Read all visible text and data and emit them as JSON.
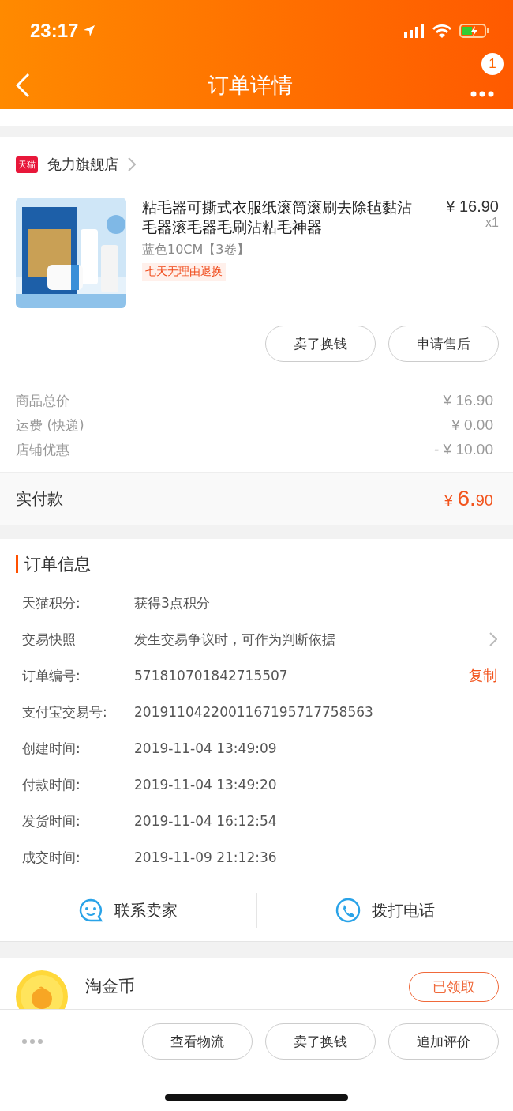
{
  "status_bar": {
    "time": "23:17"
  },
  "nav": {
    "title": "订单详情",
    "badge": "1"
  },
  "store": {
    "badge": "天猫",
    "name": "兔力旗舰店"
  },
  "product": {
    "kind": "picture",
    "title": "粘毛器可撕式衣服纸滚筒滚刷去除毡黏沾毛器滚毛器毛刷沾粘毛神器",
    "price": "¥ 16.90",
    "quantity": "x1",
    "variant": "蓝色10CM【3卷】",
    "tag": "七天无理由退换"
  },
  "item_buttons": [
    "卖了换钱",
    "申请售后"
  ],
  "price_rows": [
    {
      "label": "商品总价",
      "value": "¥ 16.90"
    },
    {
      "label": "运费 (快递)",
      "value": "¥ 0.00"
    },
    {
      "label": "店铺优惠",
      "value": "- ¥ 10.00"
    }
  ],
  "total": {
    "label": "实付款",
    "currency": "¥",
    "integer": "6.",
    "decimals": "90"
  },
  "order_info": {
    "title": "订单信息",
    "rows": [
      {
        "label": "天猫积分:",
        "value": "获得3点积分"
      },
      {
        "label": "交易快照",
        "value": "发生交易争议时，可作为判断依据",
        "kind": "link"
      },
      {
        "label": "订单编号:",
        "value": "571810701842715507",
        "action": "复制"
      },
      {
        "label": "支付宝交易号:",
        "value": "2019110422001167195717758563"
      },
      {
        "label": "创建时间:",
        "value": "2019-11-04 13:49:09"
      },
      {
        "label": "付款时间:",
        "value": "2019-11-04 13:49:20"
      },
      {
        "label": "发货时间:",
        "value": "2019-11-04 16:12:54"
      },
      {
        "label": "成交时间:",
        "value": "2019-11-09 21:12:36"
      }
    ]
  },
  "contact": [
    {
      "kind": "chat",
      "label": "联系卖家"
    },
    {
      "kind": "phone",
      "label": "拨打电话"
    }
  ],
  "coins": {
    "title": "淘金币",
    "button": "已领取"
  },
  "bottom_buttons": [
    "查看物流",
    "卖了换钱",
    "追加评价"
  ]
}
